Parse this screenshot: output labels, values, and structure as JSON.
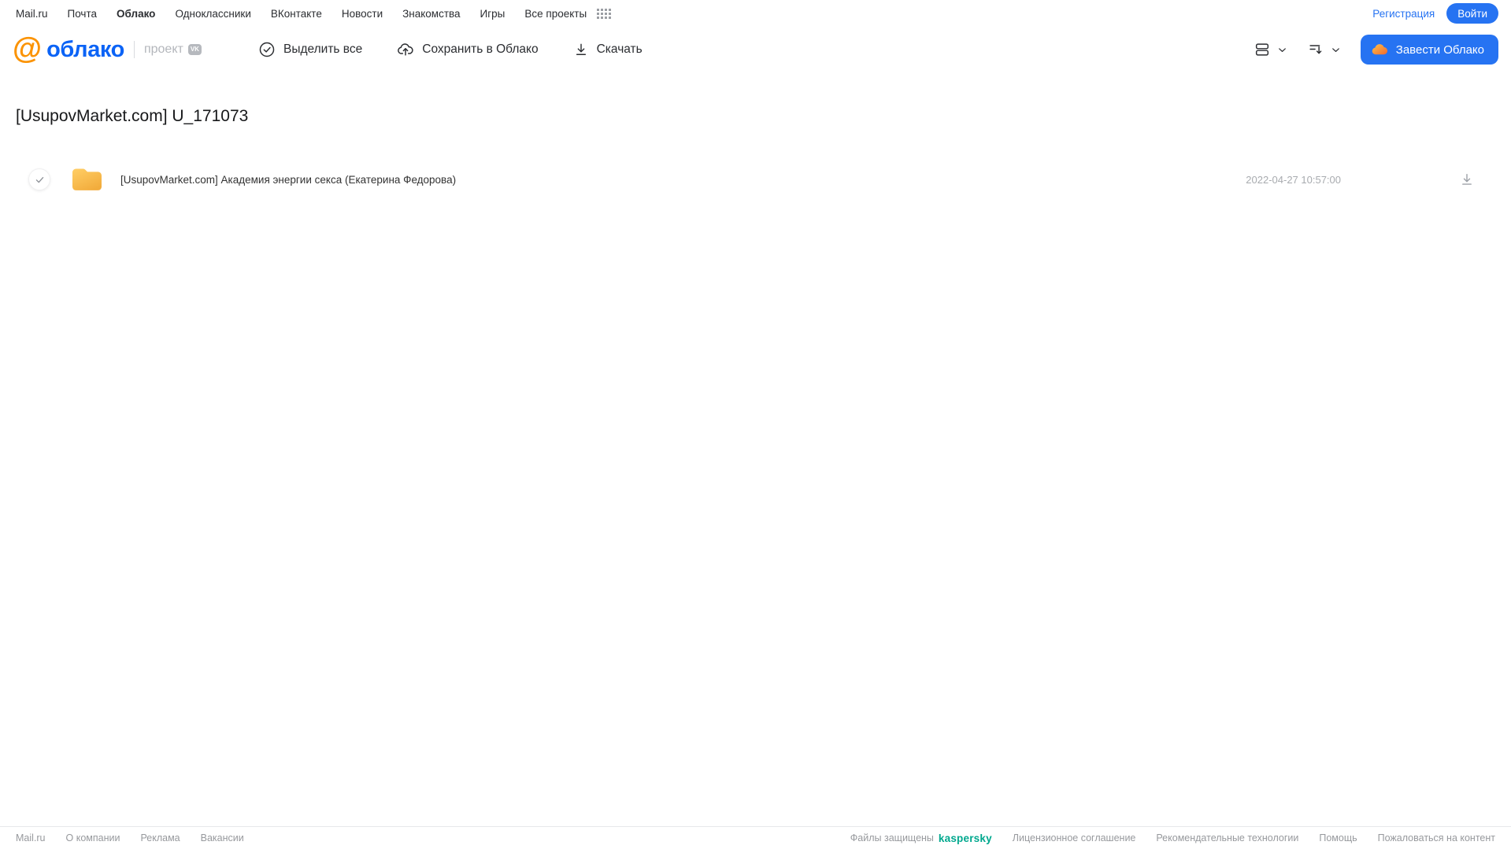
{
  "top_nav": {
    "links": [
      "Mail.ru",
      "Почта",
      "Облако",
      "Одноклассники",
      "ВКонтакте",
      "Новости",
      "Знакомства",
      "Игры",
      "Все проекты"
    ],
    "active_link": "Облако",
    "registration_label": "Регистрация",
    "login_label": "Войти"
  },
  "header": {
    "logo_at": "@",
    "logo_text": "облако",
    "project_label": "проект",
    "project_badge": "VK",
    "toolbar": {
      "select_all_label": "Выделить все",
      "save_to_cloud_label": "Сохранить в Облако",
      "download_label": "Скачать"
    },
    "get_cloud_label": "Завести Облако"
  },
  "main": {
    "title": "[UsupovMarket.com] U_171073",
    "files": [
      {
        "type": "folder",
        "name": "[UsupovMarket.com] Академия энергии секса (Екатерина Федорова)",
        "date": "2022-04-27 10:57:00"
      }
    ]
  },
  "footer": {
    "left_links": [
      "Mail.ru",
      "О компании",
      "Реклама",
      "Вакансии"
    ],
    "protected_text": "Файлы защищены",
    "kaspersky_label": "kaspersky",
    "right_links": [
      "Лицензионное соглашение",
      "Рекомендательные технологии",
      "Помощь",
      "Пожаловаться на контент"
    ]
  },
  "colors": {
    "accent_blue": "#2673f2",
    "logo_blue": "#0b63f6",
    "logo_orange": "#fb9303",
    "folder_yellow_top": "#ffcd64",
    "folder_yellow_bottom": "#f2ac3c",
    "kaspersky_teal": "#00a88e"
  }
}
